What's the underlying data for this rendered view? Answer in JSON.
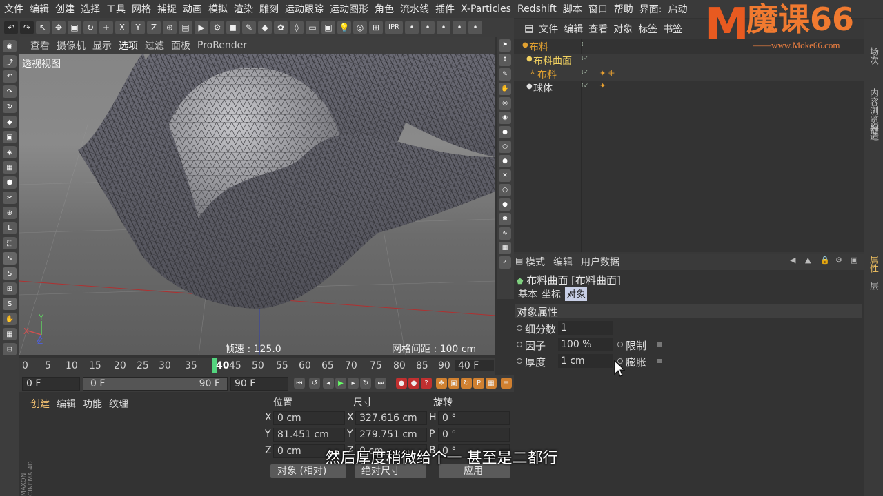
{
  "menubar": [
    "文件",
    "编辑",
    "创建",
    "选择",
    "工具",
    "网格",
    "捕捉",
    "动画",
    "模拟",
    "渲染",
    "雕刻",
    "运动跟踪",
    "运动图形",
    "角色",
    "流水线",
    "插件",
    "X-Particles",
    "Redshift",
    "脚本",
    "窗口",
    "帮助",
    "界面:",
    "启动"
  ],
  "toolbar_icons": [
    "undo-icon",
    "redo-icon",
    "select-icon",
    "move-icon",
    "scale-icon",
    "rotate-icon",
    "add-icon",
    "x-axis-icon",
    "y-axis-icon",
    "z-axis-icon",
    "coord-icon",
    "render-region-icon",
    "render-view-icon",
    "render-settings-icon",
    "cube-icon",
    "pen-icon",
    "subdivide-icon",
    "gear-icon",
    "deformer-icon",
    "floor-icon",
    "camera-icon",
    "light-icon",
    "display-icon",
    "snap-icon"
  ],
  "toolbar_ipr": "IPR",
  "viewport": {
    "menu": [
      "查看",
      "摄像机",
      "显示",
      "选项",
      "过滤",
      "面板",
      "ProRender"
    ],
    "active_menu": "选项",
    "label": "透视视图",
    "fps": "帧速 : 125.0",
    "grid": "网格间距 : 100 cm",
    "axis_y": "Y",
    "axis_x": "X",
    "axis_z": "Z"
  },
  "timeline": {
    "ticks": [
      "0",
      "5",
      "10",
      "15",
      "20",
      "25",
      "30",
      "35",
      "40",
      "45",
      "50",
      "55",
      "60",
      "65",
      "70",
      "75",
      "80",
      "85",
      "90"
    ],
    "current": "40",
    "end_label": "40 F"
  },
  "transport": {
    "start": "0 F",
    "range_start": "0 F",
    "range_end": "90 F",
    "end": "90 F"
  },
  "material_panel": {
    "menu": [
      "创建",
      "编辑",
      "功能",
      "纹理"
    ],
    "brand": "MAXON CINEMA 4D"
  },
  "coords": {
    "headers": [
      "位置",
      "尺寸",
      "旋转"
    ],
    "rows": [
      {
        "axis": "X",
        "pos": "0 cm",
        "size_axis": "X",
        "size": "327.616 cm",
        "rot_axis": "H",
        "rot": "0 °"
      },
      {
        "axis": "Y",
        "pos": "81.451 cm",
        "size_axis": "Y",
        "size": "279.751 cm",
        "rot_axis": "P",
        "rot": "0 °"
      },
      {
        "axis": "Z",
        "pos": "0 cm",
        "size_axis": "Z",
        "size": "0 cm",
        "rot_axis": "B",
        "rot": "0 °"
      }
    ],
    "mode": "对象 (相对)",
    "size_mode": "绝对尺寸",
    "apply": "应用"
  },
  "object_manager": {
    "menu": [
      "文件",
      "编辑",
      "查看",
      "对象",
      "标签",
      "书签"
    ],
    "items": [
      {
        "name": "布料",
        "level": 0,
        "color": "#e0a030"
      },
      {
        "name": "布料曲面",
        "level": 1,
        "color": "#f0d060"
      },
      {
        "name": "布料",
        "level": 2,
        "color": "#e0a030"
      },
      {
        "name": "球体",
        "level": 1,
        "color": "#e0e0e0"
      }
    ]
  },
  "attributes": {
    "menu": [
      "模式",
      "编辑",
      "用户数据"
    ],
    "title": "布料曲面 [布料曲面]",
    "tabs": [
      "基本",
      "坐标",
      "对象"
    ],
    "active_tab": "对象",
    "section": "对象属性",
    "props": [
      {
        "label": "细分数",
        "value": "1"
      },
      {
        "label": "因子",
        "value": "100 %",
        "extra": "限制"
      },
      {
        "label": "厚度",
        "value": "1 cm",
        "extra": "膨胀"
      }
    ]
  },
  "side_tabs": [
    "场次",
    "内容浏览器",
    "构造",
    "属性",
    "层"
  ],
  "logo": {
    "text": "魔课66",
    "letter": "M",
    "url": "——www.Moke66.com"
  },
  "subtitle": "然后厚度稍微给个一 甚至是二都行"
}
